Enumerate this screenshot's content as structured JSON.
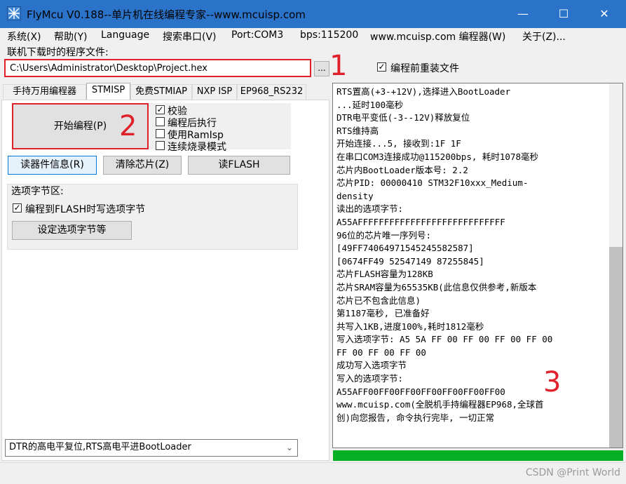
{
  "window": {
    "title": "FlyMcu V0.188--单片机在线编程专家--www.mcuisp.com",
    "minimize": "—",
    "maximize": "☐",
    "close": "✕"
  },
  "menu": [
    "系统(X)",
    "帮助(Y)",
    "Language",
    "搜索串口(V)",
    "Port:COM3",
    "bps:115200",
    "www.mcuisp.com 编程器(W)",
    "关于(Z)..."
  ],
  "file": {
    "label": "联机下载时的程序文件:",
    "path": "C:\\Users\\Administrator\\Desktop\\Project.hex",
    "browse": "...",
    "reload_label": "编程前重装文件",
    "reload_checked": true
  },
  "annotations": {
    "one": "1",
    "two": "2",
    "three": "3"
  },
  "tabs": [
    "手持万用编程器",
    "STMISP",
    "免费STMIAP",
    "NXP ISP",
    "EP968_RS232"
  ],
  "stmisp": {
    "start_button": "开始编程(P)",
    "options": [
      {
        "label": "校验",
        "checked": true
      },
      {
        "label": "编程后执行",
        "checked": false
      },
      {
        "label": "使用RamIsp",
        "checked": false
      },
      {
        "label": "连续烧录模式",
        "checked": false
      }
    ],
    "read_info_button": "读器件信息(R)",
    "erase_button": "清除芯片(Z)",
    "read_flash_button": "读FLASH",
    "option_group": {
      "title": "选项字节区:",
      "write_option_label": "编程到FLASH时写选项字节",
      "write_option_checked": true,
      "set_button": "设定选项字节等"
    }
  },
  "port_mode": "DTR的高电平复位,RTS高电平进BootLoader",
  "log": [
    "RTS置高(+3-+12V),选择进入BootLoader",
    "...延时100毫秒",
    "DTR电平变低(-3--12V)释放复位",
    "RTS维持高",
    "开始连接...5, 接收到:1F 1F",
    "在串口COM3连接成功@115200bps, 耗时1078毫秒",
    "芯片内BootLoader版本号: 2.2",
    "芯片PID: 00000410  STM32F10xxx_Medium-",
    "density",
    "读出的选项字节:",
    "A55AFFFFFFFFFFFFFFFFFFFFFFFFFFFF",
    "96位的芯片唯一序列号:",
    "[49FF74064971545245582587]",
    "[0674FF49 52547149 87255845]",
    "芯片FLASH容量为128KB",
    "芯片SRAM容量为65535KB(此信息仅供参考,新版本",
    "芯片已不包含此信息)",
    "第1187毫秒, 已准备好",
    "共写入1KB,进度100%,耗时1812毫秒",
    "写入选项字节:  A5 5A FF 00 FF 00 FF 00 FF 00",
    "FF 00 FF 00 FF 00",
    "成功写入选项字节",
    "写入的选项字节:",
    "A55AFF00FF00FF00FF00FF00FF00FF00",
    "www.mcuisp.com(全脱机手持编程器EP968,全球首",
    "创)向您报告, 命令执行完毕, 一切正常"
  ],
  "progress": 1.0,
  "watermark": "CSDN @Print World",
  "colors": {
    "titlebar": "#2b73c9",
    "highlight": "#e0202a",
    "progress": "#06b025"
  }
}
